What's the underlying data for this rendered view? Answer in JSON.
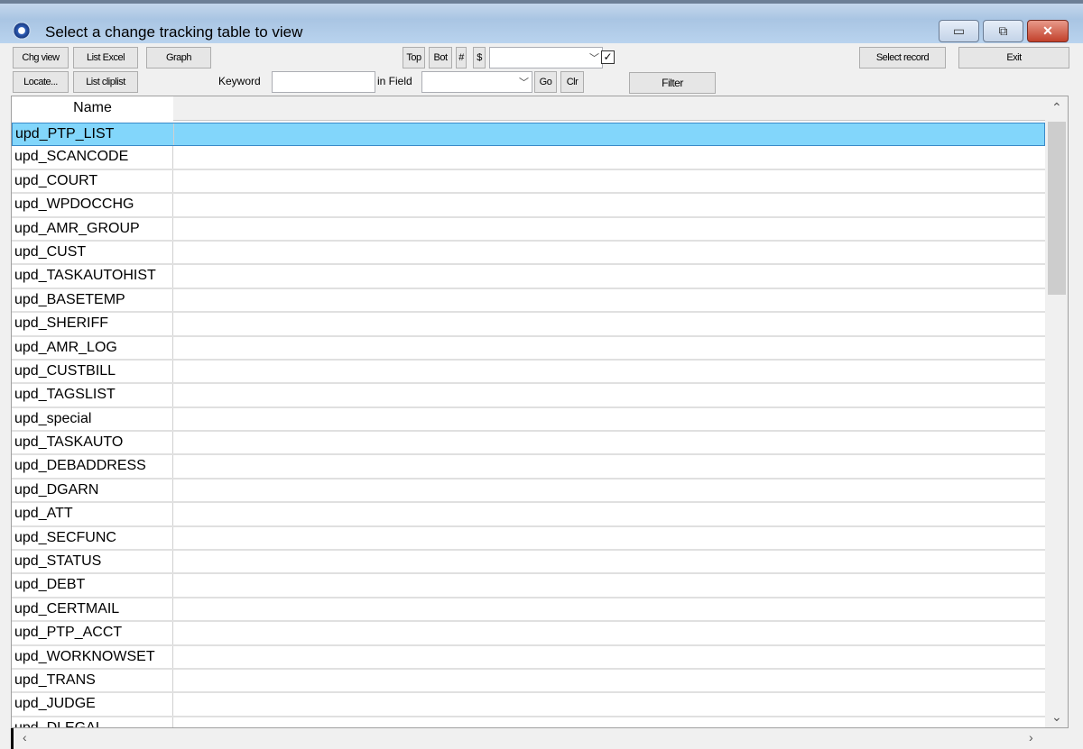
{
  "window": {
    "title": "Select a change tracking table to view",
    "minimize": "▭",
    "restore": "⧉",
    "close": "✕"
  },
  "toolbar": {
    "chg_view": "Chg view",
    "list_excel": "List Excel",
    "graph": "Graph",
    "locate": "Locate...",
    "list_cliplist": "List cliplist",
    "top": "Top",
    "bot": "Bot",
    "hash": "#",
    "dollar": "$",
    "keyword_label": "Keyword",
    "keyword_value": "",
    "in_field_label": "in Field",
    "field_value": "",
    "go": "Go",
    "clr": "Clr",
    "filter": "Filter",
    "select_record": "Select record",
    "exit": "Exit",
    "checkbox_checked": true
  },
  "grid": {
    "header": "Name",
    "selected_index": 0,
    "rows": [
      "upd_PTP_LIST",
      "upd_SCANCODE",
      "upd_COURT",
      "upd_WPDOCCHG",
      "upd_AMR_GROUP",
      "upd_CUST",
      "upd_TASKAUTOHIST",
      "upd_BASETEMP",
      "upd_SHERIFF",
      "upd_AMR_LOG",
      "upd_CUSTBILL",
      "upd_TAGSLIST",
      "upd_special",
      "upd_TASKAUTO",
      "upd_DEBADDRESS",
      "upd_DGARN",
      "upd_ATT",
      "upd_SECFUNC",
      "upd_STATUS",
      "upd_DEBT",
      "upd_CERTMAIL",
      "upd_PTP_ACCT",
      "upd_WORKNOWSET",
      "upd_TRANS",
      "upd_JUDGE",
      "upd_DLEGAL"
    ]
  }
}
